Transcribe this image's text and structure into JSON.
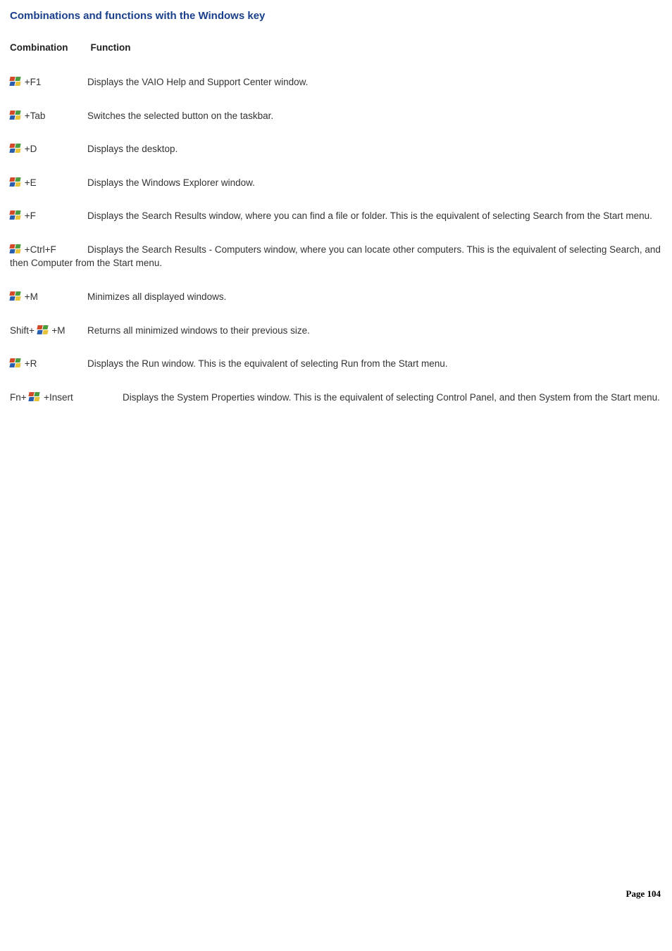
{
  "title": "Combinations and functions with the Windows key",
  "headers": {
    "combination": "Combination",
    "function": "Function"
  },
  "rows": [
    {
      "combo_parts": {
        "prefix": "",
        "suffix": " +F1"
      },
      "function": "Displays the VAIO Help and Support Center window.",
      "tabular": true
    },
    {
      "combo_parts": {
        "prefix": "",
        "suffix": " +Tab"
      },
      "function": "Switches the selected button on the taskbar.",
      "tabular": true
    },
    {
      "combo_parts": {
        "prefix": "",
        "suffix": " +D"
      },
      "function": "Displays the desktop.",
      "tabular": true
    },
    {
      "combo_parts": {
        "prefix": "",
        "suffix": " +E"
      },
      "function": "Displays the Windows Explorer window.",
      "tabular": true
    },
    {
      "combo_parts": {
        "prefix": "",
        "suffix": " +F"
      },
      "function": "Displays the Search Results window, where you can find a file or folder. This is the equivalent of selecting Search from the Start menu.",
      "tabular": false,
      "combo_width": 110
    },
    {
      "combo_parts": {
        "prefix": "",
        "suffix": " +Ctrl+F"
      },
      "function": "Displays the Search Results - Computers window, where you can locate other computers. This is the equivalent of selecting Search, and then Computer from the Start menu.",
      "tabular": false,
      "combo_width": 110
    },
    {
      "combo_parts": {
        "prefix": "",
        "suffix": " +M"
      },
      "function": "Minimizes all displayed windows.",
      "tabular": true
    },
    {
      "combo_parts": {
        "prefix": "Shift+ ",
        "suffix": "  +M"
      },
      "function": "Returns all minimized windows to their previous size.",
      "tabular": true,
      "combo_width": 110
    },
    {
      "combo_parts": {
        "prefix": "",
        "suffix": " +R"
      },
      "function": "Displays the Run window. This is the equivalent of selecting Run from the Start menu.",
      "tabular": true
    },
    {
      "combo_parts": {
        "prefix": "Fn+ ",
        "suffix": "  +Insert"
      },
      "function": "Displays the System Properties window. This is the equivalent of selecting Control Panel, and then System from the Start menu.",
      "tabular": false,
      "combo_width": 160
    }
  ],
  "footer": {
    "label": "Page ",
    "number": "104"
  }
}
